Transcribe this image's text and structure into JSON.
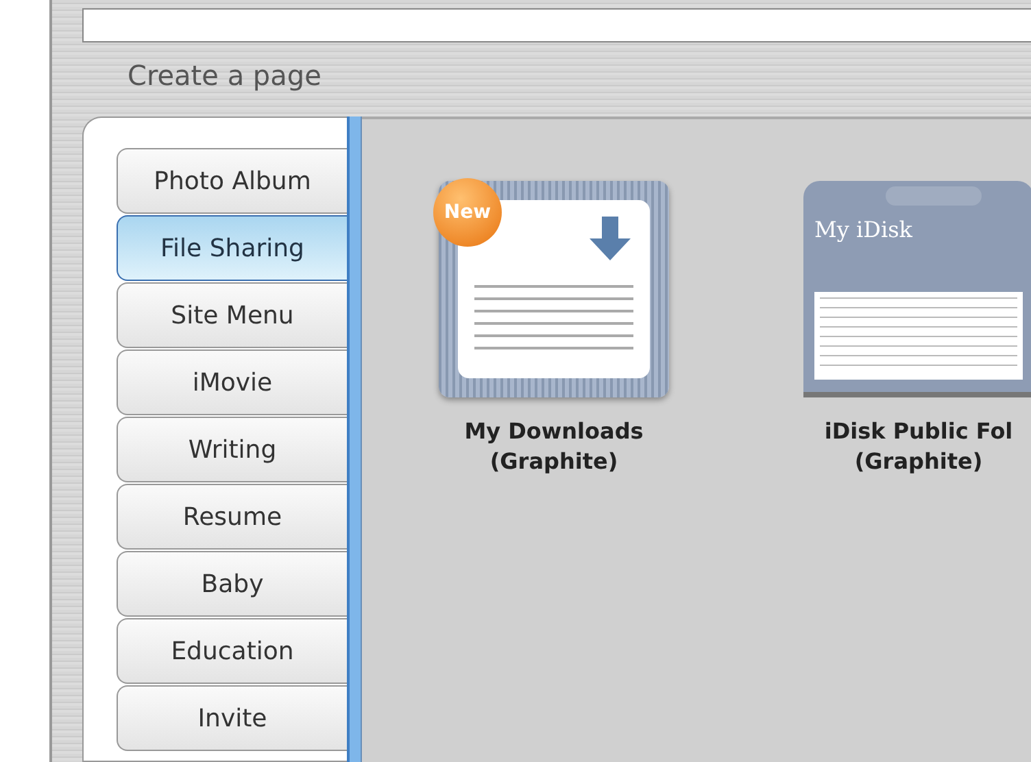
{
  "title": "Create a page",
  "tabs": [
    {
      "label": "Photo Album",
      "selected": false
    },
    {
      "label": "File Sharing",
      "selected": true
    },
    {
      "label": "Site Menu",
      "selected": false
    },
    {
      "label": "iMovie",
      "selected": false
    },
    {
      "label": "Writing",
      "selected": false
    },
    {
      "label": "Resume",
      "selected": false
    },
    {
      "label": "Baby",
      "selected": false
    },
    {
      "label": "Education",
      "selected": false
    },
    {
      "label": "Invite",
      "selected": false
    }
  ],
  "templates": [
    {
      "kind": "downloads",
      "badge": "New",
      "name": "My Downloads",
      "variant": "(Graphite)"
    },
    {
      "kind": "idisk",
      "heading": "My iDisk",
      "name": "iDisk Public Fol",
      "variant": "(Graphite)"
    }
  ]
}
